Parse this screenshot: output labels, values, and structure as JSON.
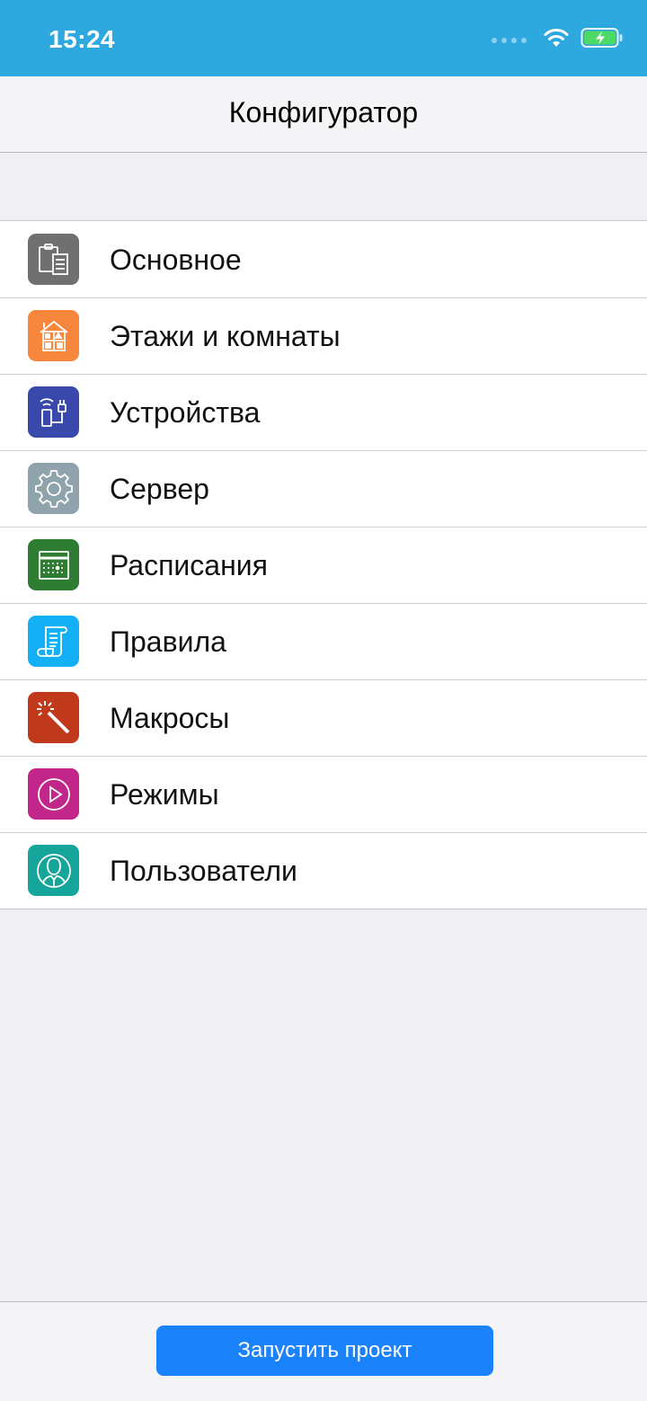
{
  "status_bar": {
    "time": "15:24",
    "background": "#2ea9e0",
    "icons": [
      "signal-dots-icon",
      "wifi-icon",
      "battery-charging-icon"
    ]
  },
  "nav": {
    "title": "Конфигуратор"
  },
  "menu": {
    "items": [
      {
        "label": "Основное",
        "icon": "clipboard-icon",
        "color": "#707070"
      },
      {
        "label": "Этажи и комнаты",
        "icon": "house-icon",
        "color": "#f6873c"
      },
      {
        "label": "Устройства",
        "icon": "device-plug-icon",
        "color": "#3949ab"
      },
      {
        "label": "Сервер",
        "icon": "gear-icon",
        "color": "#8fa3ad"
      },
      {
        "label": "Расписания",
        "icon": "calendar-icon",
        "color": "#2e7d32"
      },
      {
        "label": "Правила",
        "icon": "scroll-icon",
        "color": "#13b0f5"
      },
      {
        "label": "Макросы",
        "icon": "magic-wand-icon",
        "color": "#c0391a"
      },
      {
        "label": "Режимы",
        "icon": "play-circle-icon",
        "color": "#c2268a"
      },
      {
        "label": "Пользователи",
        "icon": "user-circle-icon",
        "color": "#16a59a"
      }
    ]
  },
  "footer": {
    "start_button": "Запустить проект",
    "accent": "#1a82fb"
  }
}
